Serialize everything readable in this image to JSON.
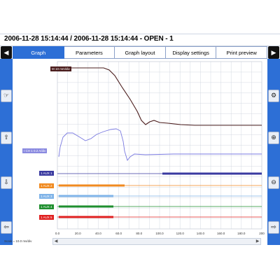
{
  "window": {
    "title": "2006-11-28 15:14:44 / 2006-11-28 15:14:44 - OPEN - 1"
  },
  "tabs": [
    {
      "label": "Graph",
      "active": true
    },
    {
      "label": "Parameters",
      "active": false
    },
    {
      "label": "Graph layout",
      "active": false
    },
    {
      "label": "Display settings",
      "active": false
    },
    {
      "label": "Print preview",
      "active": false
    }
  ],
  "nav": {
    "prev_icon": "chevron-left-icon",
    "next_icon": "chevron-right-icon"
  },
  "channels": [
    {
      "label": "M 10 mm/div",
      "color": "#4a1c1c"
    },
    {
      "label": "I CH 1 0.2 A/div",
      "color": "#8a8ae0"
    },
    {
      "label": "1 AUX 1",
      "color": "#3a3aa0"
    },
    {
      "label": "1 AUX 2",
      "color": "#f08a20"
    },
    {
      "label": "1 AUX 3",
      "color": "#7fb3e8"
    },
    {
      "label": "1 AUX 4",
      "color": "#1f8f2f"
    },
    {
      "label": "1 AUX 5",
      "color": "#e02020"
    }
  ],
  "x_axis": {
    "ticks": [
      "0.0",
      "20.0",
      "40.0",
      "60.0",
      "80.0",
      "100.0",
      "120.0",
      "140.0",
      "160.0",
      "180.0",
      "200"
    ]
  },
  "scale_label": "Scale = 10.0 ms/div",
  "colors": {
    "accent": "#2d6fd6",
    "motion": "#4a1c1c",
    "current": "#7a7ae0"
  },
  "left_tools": [
    "hand-icon",
    "arrow-up-icon",
    "arrow-down-icon",
    "arrow-left-icon"
  ],
  "right_tools": [
    "gear-icon",
    "zoom-in-icon",
    "zoom-out-icon",
    "arrow-right-icon"
  ]
}
